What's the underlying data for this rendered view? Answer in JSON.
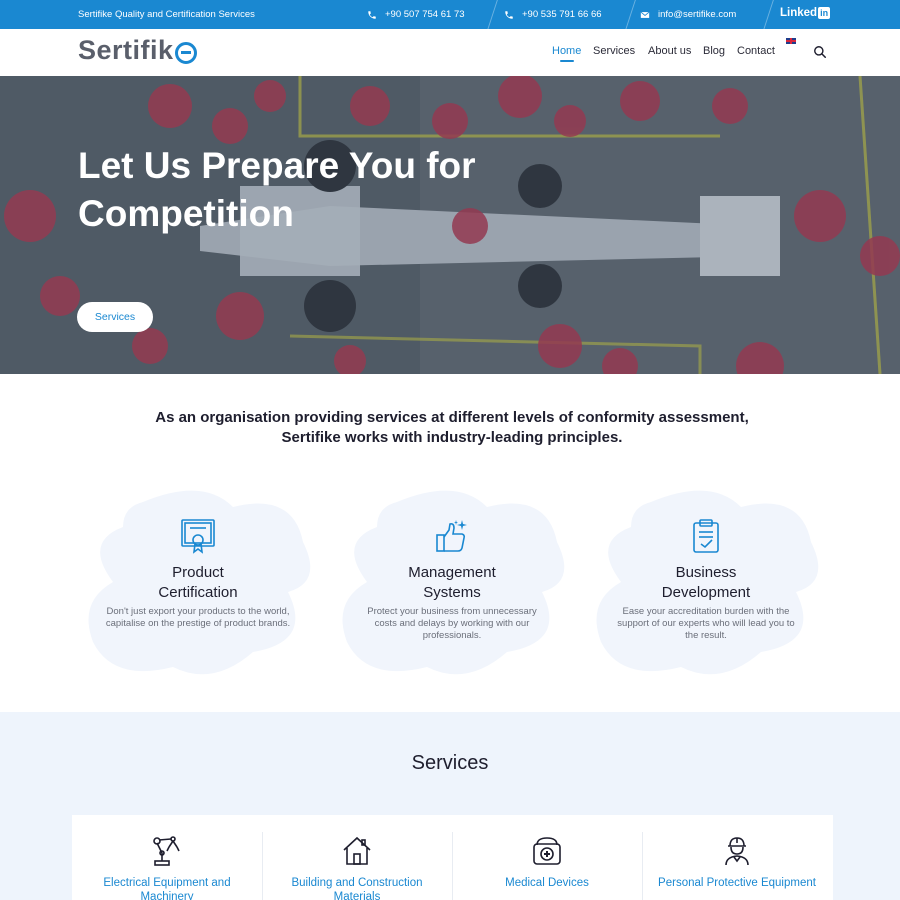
{
  "topbar": {
    "tagline": "Sertifike Quality and Certification Services",
    "phone_1": "+90 507 754 61 73",
    "phone_2": "+90 535 791 66 66",
    "email": "info@sertifike.com",
    "linkedin_label": "Linked",
    "linkedin_badge": "in"
  },
  "header": {
    "logo_text": "Sertifik",
    "nav": [
      {
        "label": "Home",
        "active": true
      },
      {
        "label": "Services"
      },
      {
        "label": "About us"
      },
      {
        "label": "Blog"
      },
      {
        "label": "Contact"
      }
    ],
    "language_icon": "uk-flag-icon"
  },
  "hero": {
    "title": "Let Us Prepare You for Competition",
    "button_label": "Services"
  },
  "intro": {
    "text": "As an organisation providing services at different levels of conformity assessment, Sertifike works with industry-leading principles."
  },
  "features": [
    {
      "icon": "certificate-icon",
      "title_line1": "Product",
      "title_line2": "Certification",
      "description": "Don't just export your products to the world, capitalise on the prestige of product brands."
    },
    {
      "icon": "thumbs-up-icon",
      "title_line1": "Management",
      "title_line2": "Systems",
      "description": "Protect your business from unnecessary costs and delays by working with our professionals."
    },
    {
      "icon": "clipboard-check-icon",
      "title_line1": "Business",
      "title_line2": "Development",
      "description": "Ease your accreditation burden with the support of our experts who will lead you to the result."
    }
  ],
  "services": {
    "heading": "Services",
    "items": [
      {
        "icon": "robot-arm-icon",
        "label": "Electrical Equipment and Machinery"
      },
      {
        "icon": "house-icon",
        "label": "Building and Construction Materials"
      },
      {
        "icon": "medical-kit-icon",
        "label": "Medical Devices"
      },
      {
        "icon": "hard-hat-worker-icon",
        "label": "Personal Protective Equipment"
      }
    ]
  },
  "colors": {
    "brand_blue": "#1a88d1",
    "services_bg": "#eef4fc",
    "blob_bg": "#f1f5fc"
  }
}
